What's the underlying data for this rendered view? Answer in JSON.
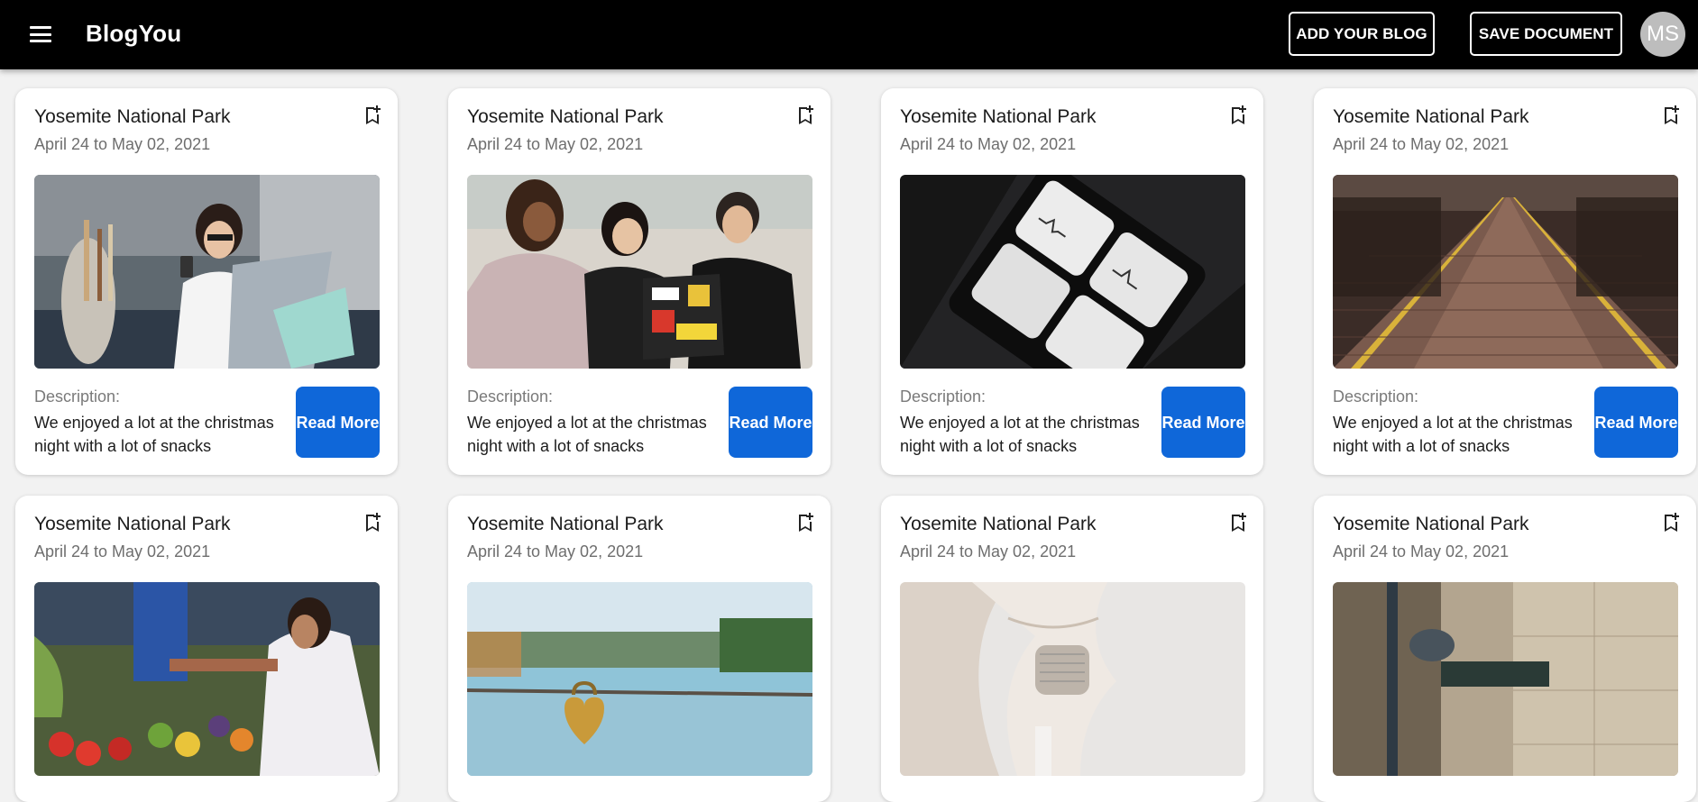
{
  "header": {
    "brand": "BlogYou",
    "add_blog_label": "ADD YOUR BLOG",
    "save_document_label": "SAVE DOCUMENT",
    "avatar_initials": "MS"
  },
  "cards": [
    {
      "title": "Yosemite National Park",
      "date": "April 24 to May 02, 2021",
      "description_label": "Description:",
      "description": "We enjoyed a lot at the christmas night with a lot of snacks",
      "read_more_label": "Read More",
      "image": "woman-with-laptop-and-phone"
    },
    {
      "title": "Yosemite National Park",
      "date": "April 24 to May 02, 2021",
      "description_label": "Description:",
      "description": "We enjoyed a lot at the christmas night with a lot of snacks",
      "read_more_label": "Read More",
      "image": "three-women-at-laptop"
    },
    {
      "title": "Yosemite National Park",
      "date": "April 24 to May 02, 2021",
      "description_label": "Description:",
      "description": "We enjoyed a lot at the christmas night with a lot of snacks",
      "read_more_label": "Read More",
      "image": "analytics-app-on-phone"
    },
    {
      "title": "Yosemite National Park",
      "date": "April 24 to May 02, 2021",
      "description_label": "Description:",
      "description": "We enjoyed a lot at the christmas night with a lot of snacks",
      "read_more_label": "Read More",
      "image": "brick-street"
    },
    {
      "title": "Yosemite National Park",
      "date": "April 24 to May 02, 2021",
      "image": "vegetable-market"
    },
    {
      "title": "Yosemite National Park",
      "date": "April 24 to May 02, 2021",
      "image": "heart-padlock-by-lake"
    },
    {
      "title": "Yosemite National Park",
      "date": "April 24 to May 02, 2021",
      "image": "white-architecture"
    },
    {
      "title": "Yosemite National Park",
      "date": "April 24 to May 02, 2021",
      "image": "wall-street-sign"
    }
  ],
  "colors": {
    "appbar": "#000000",
    "page_background": "#f2f2f2",
    "read_more_button": "#0f67d9",
    "avatar": "#bdbdbd"
  }
}
